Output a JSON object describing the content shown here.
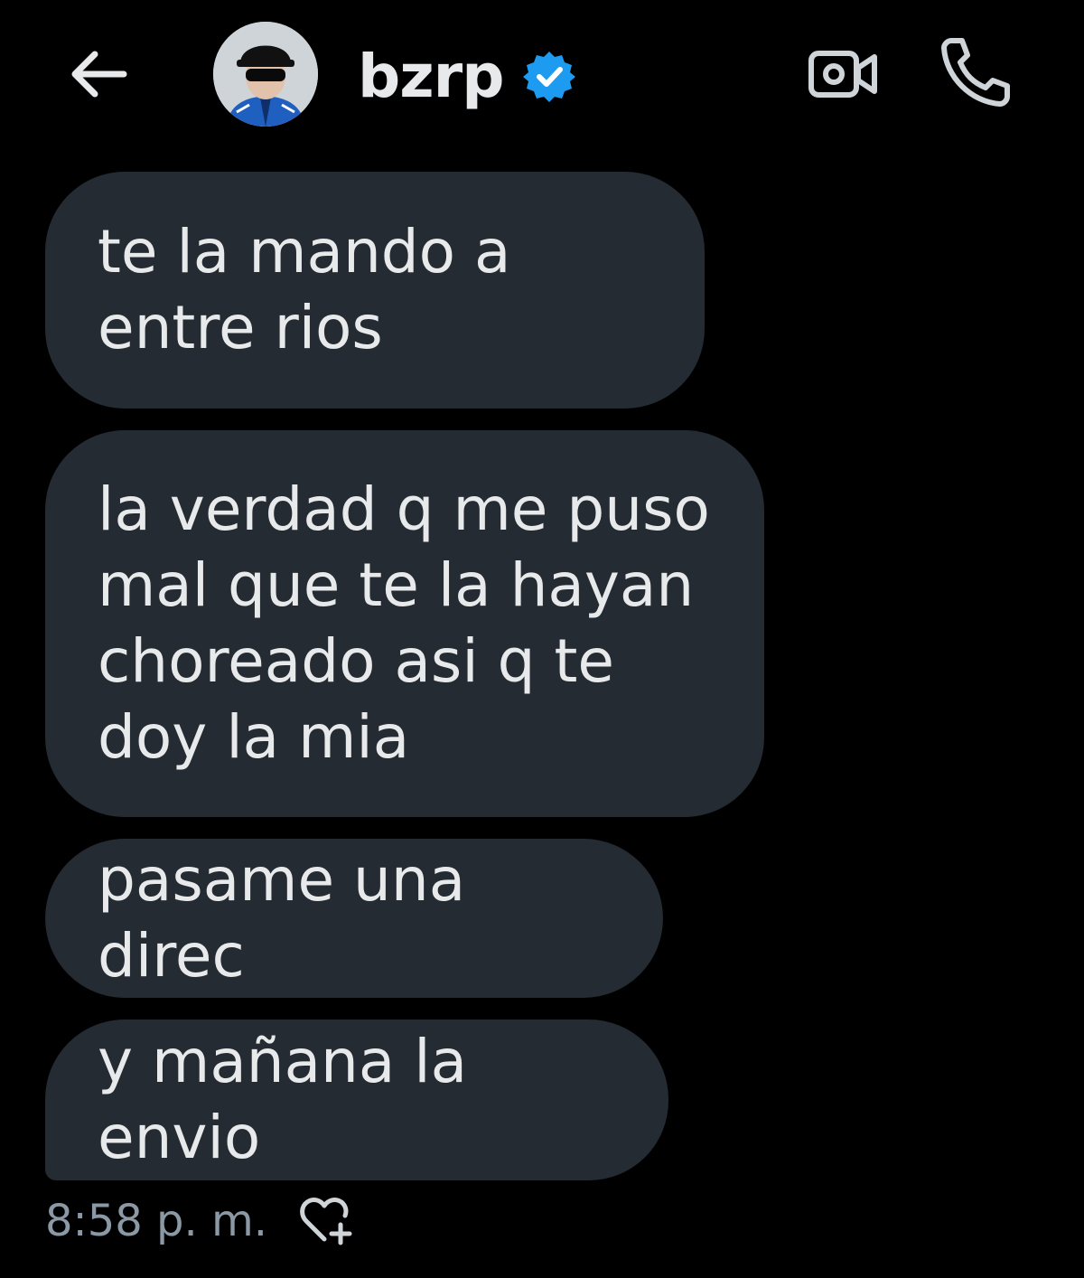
{
  "header": {
    "title": "bzrp",
    "back_icon": "arrow-left-icon",
    "verified_icon": "verified-badge-icon",
    "video_icon": "video-camera-icon",
    "call_icon": "phone-icon"
  },
  "messages": [
    {
      "text": "te la mando a entre rios"
    },
    {
      "text": "la verdad q me puso mal que te la hayan choreado asi q te doy la mia"
    },
    {
      "text": "pasame una direc"
    },
    {
      "text": "y mañana la envio"
    }
  ],
  "footer": {
    "timestamp": "8:58 p. m.",
    "react_icon": "heart-plus-icon"
  },
  "colors": {
    "background": "#000000",
    "bubble": "#242b32",
    "text": "#e7e9ea",
    "muted": "#8b98a5",
    "verified": "#1d9bf0"
  }
}
